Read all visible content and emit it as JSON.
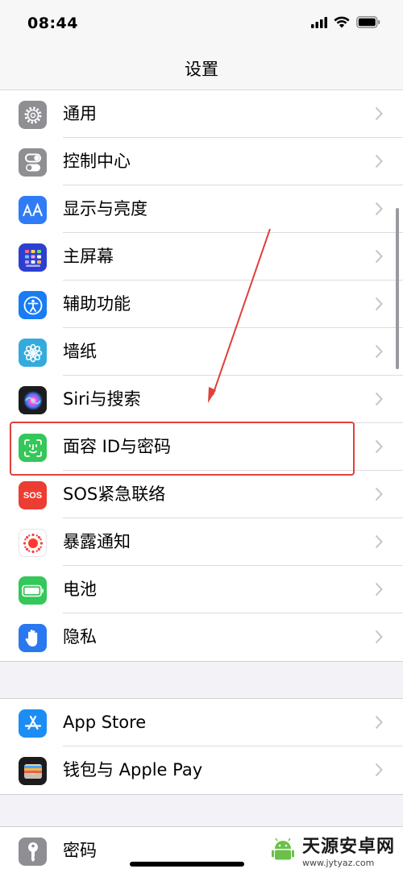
{
  "status_bar": {
    "time": "08:44"
  },
  "nav": {
    "title": "设置"
  },
  "group1": [
    {
      "label": "通用",
      "icon": "gear-icon",
      "color": "#8e8e93"
    },
    {
      "label": "控制中心",
      "icon": "toggles-icon",
      "color": "#8e8e93"
    },
    {
      "label": "显示与亮度",
      "icon": "text-size-icon",
      "color": "#2f7cf6"
    },
    {
      "label": "主屏幕",
      "icon": "app-grid-icon",
      "color": "#2c3fd1"
    },
    {
      "label": "辅助功能",
      "icon": "accessibility-icon",
      "color": "#1a7cf2"
    },
    {
      "label": "墙纸",
      "icon": "flower-icon",
      "color": "#35aadc"
    },
    {
      "label": "Siri与搜索",
      "icon": "siri-icon",
      "color": "#1c1c1e"
    },
    {
      "label": "面容 ID与密码",
      "icon": "face-id-icon",
      "color": "#34c759"
    },
    {
      "label": "SOS紧急联络",
      "icon": "sos-icon",
      "color": "#ec3d33",
      "icon_text": "SOS"
    },
    {
      "label": "暴露通知",
      "icon": "exposure-icon",
      "color": "#ffffff"
    },
    {
      "label": "电池",
      "icon": "battery-icon",
      "color": "#34c759"
    },
    {
      "label": "隐私",
      "icon": "hand-icon",
      "color": "#2a78f0"
    }
  ],
  "group2": [
    {
      "label": "App Store",
      "icon": "app-store-icon",
      "color": "#1c8df5"
    },
    {
      "label": "钱包与 Apple Pay",
      "icon": "wallet-icon",
      "color": "#1c1c1e"
    }
  ],
  "group3": [
    {
      "label": "密码",
      "icon": "key-icon",
      "color": "#8e8e93"
    }
  ],
  "annotation": {
    "color": "#e0403a"
  },
  "watermark": {
    "name": "天源安卓网",
    "url": "www.jytyaz.com"
  }
}
